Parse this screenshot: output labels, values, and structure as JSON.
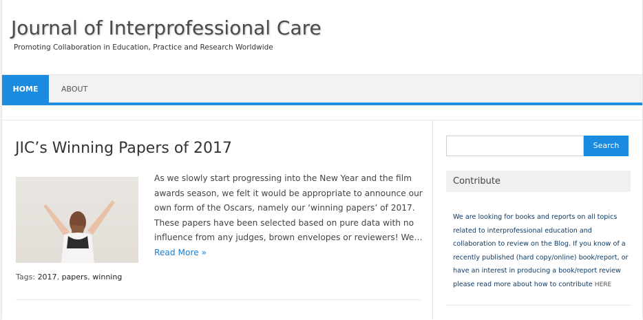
{
  "header": {
    "title": "Journal of Interprofessional Care",
    "description": "Promoting Collaboration in Education, Practice and Research Worldwide"
  },
  "nav": {
    "items": [
      {
        "label": "HOME",
        "active": true
      },
      {
        "label": "ABOUT",
        "active": false
      }
    ],
    "accent_color": "#1b8be0"
  },
  "post": {
    "title": "JIC’s Winning Papers of 2017",
    "excerpt": "As we slowly start progressing into the New Year and the film awards season, we felt it would be appropriate to announce our own form of the Oscars, namely our ‘winning papers’ of 2017. These papers have been selected based on pure data with no influence from any judges, brown envelopes or reviewers!   We…",
    "read_more": "Read More »",
    "tags_label": "Tags:",
    "tags": [
      "2017",
      "papers",
      "winning"
    ],
    "thumbnail_icon": "woman-arms-raised-photo"
  },
  "sidebar": {
    "search": {
      "placeholder": "",
      "button_label": "Search"
    },
    "contribute": {
      "title": "Contribute",
      "text": "We are looking for books and reports on all topics related to interprofessional education and collaboration to review on the Blog. If you know of a recently published (hard copy/online) book/report, or have an interest in producing a book/report review please read more about how to contribute",
      "link_label": "HERE"
    }
  }
}
